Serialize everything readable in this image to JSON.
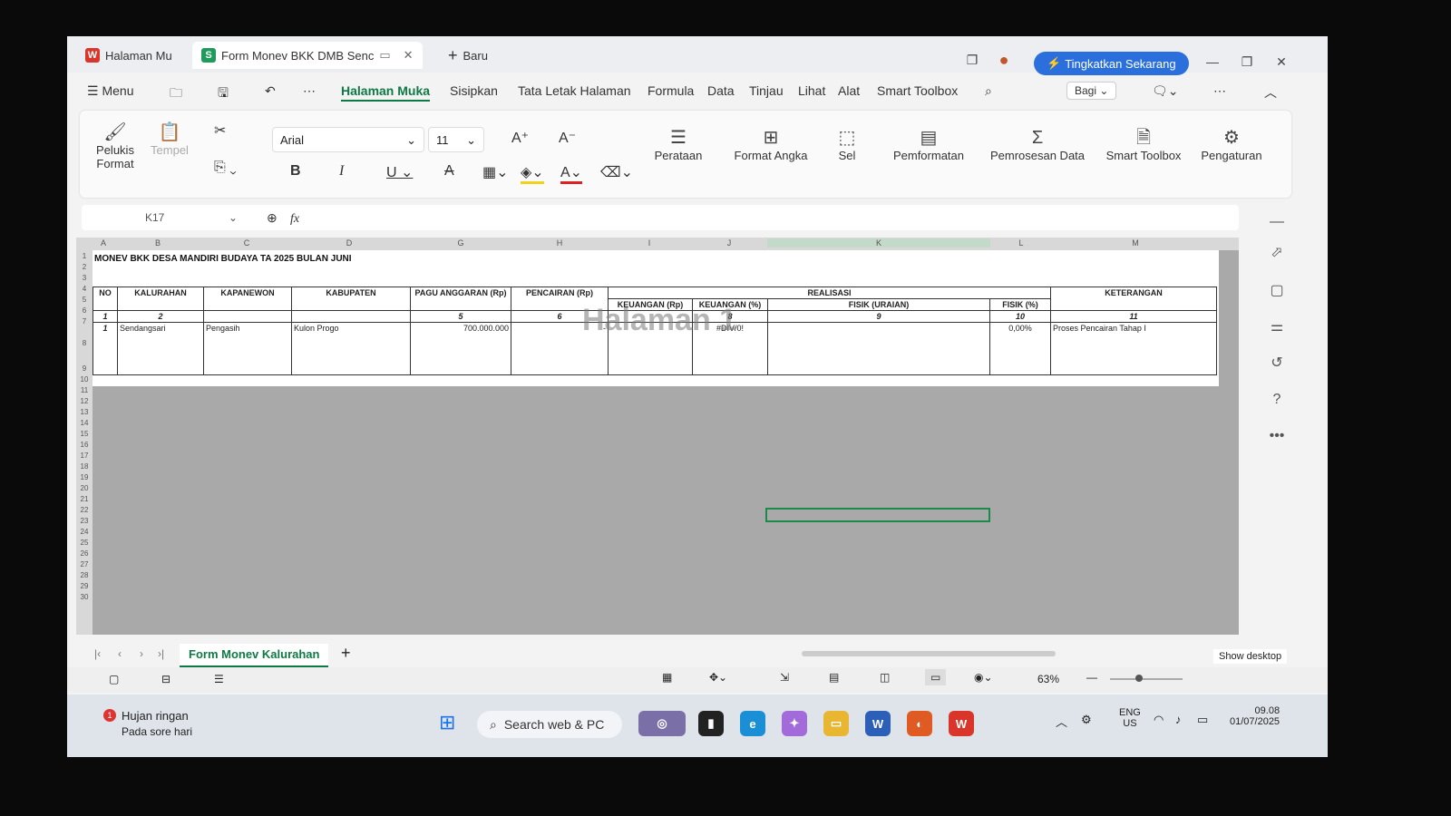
{
  "window": {
    "tabs": [
      {
        "label": "Halaman Mu",
        "badge": "W"
      },
      {
        "label": "Form Monev BKK DMB Senc",
        "badge": "S"
      }
    ],
    "new_tab_label": "Baru",
    "upgrade_label": "Tingkatkan Sekarang"
  },
  "menu": {
    "menu_label": "Menu",
    "items": [
      "Halaman Muka",
      "Sisipkan",
      "Tata Letak Halaman",
      "Formula",
      "Data",
      "Tinjau",
      "Lihat",
      "Alat",
      "Smart Toolbox"
    ],
    "share_label": "Bagi"
  },
  "ribbon": {
    "format_painter_line1": "Pelukis",
    "format_painter_line2": "Format",
    "paste_label": "Tempel",
    "font_name": "Arial",
    "font_size": "11",
    "groups": [
      "Perataan",
      "Format Angka",
      "Sel",
      "Pemformatan",
      "Pemrosesan Data",
      "Smart Toolbox",
      "Pengaturan"
    ]
  },
  "formula_bar": {
    "cell_ref": "K17",
    "fx_label": "fx"
  },
  "grid": {
    "columns": [
      "A",
      "B",
      "C",
      "D",
      "G",
      "H",
      "I",
      "J",
      "K",
      "L",
      "M"
    ],
    "rows": [
      "1",
      "2",
      "3",
      "4",
      "5",
      "6",
      "7",
      "8",
      "9",
      "10",
      "11",
      "12",
      "13",
      "14",
      "15",
      "16",
      "17",
      "18",
      "19",
      "20",
      "21",
      "22",
      "23",
      "24",
      "25",
      "26",
      "27",
      "28",
      "29",
      "30"
    ],
    "title": "MONEV BKK DESA MANDIRI BUDAYA TA 2025 BULAN JUNI",
    "watermark": "Halaman 1",
    "headers": {
      "no": "NO",
      "kalurahan": "KALURAHAN",
      "kapanewon": "KAPANEWON",
      "kabupaten": "KABUPATEN",
      "pagu": "PAGU ANGGARAN (Rp)",
      "pencairan": "PENCAIRAN (Rp)",
      "realisasi": "REALISASI",
      "keuangan_rp": "KEUANGAN (Rp)",
      "keuangan_pct": "KEUANGAN (%)",
      "fisik_uraian": "FISIK (URAIAN)",
      "fisik_pct": "FISIK (%)",
      "keterangan": "KETERANGAN"
    },
    "index_row": [
      "1",
      "2",
      "5",
      "6",
      "8",
      "9",
      "10",
      "11"
    ],
    "data_row": {
      "no": "1",
      "kalurahan": "Sendangsari",
      "kapanewon": "Pengasih",
      "kabupaten": "Kulon Progo",
      "pagu": "700.000.000",
      "pencairan": "-",
      "keuangan_rp": "",
      "keuangan_pct": "#DIV/0!",
      "fisik_uraian": "",
      "fisik_pct": "0,00%",
      "keterangan": "Proses Pencairan Tahap I"
    }
  },
  "sheets": {
    "active": "Form Monev Kalurahan",
    "show_desktop": "Show desktop"
  },
  "status": {
    "zoom": "63%"
  },
  "taskbar": {
    "weather_title": "Hujan ringan",
    "weather_sub": "Pada sore hari",
    "search_placeholder": "Search web & PC",
    "lang_line1": "ENG",
    "lang_line2": "US",
    "time": "09.08",
    "date": "01/07/2025"
  }
}
